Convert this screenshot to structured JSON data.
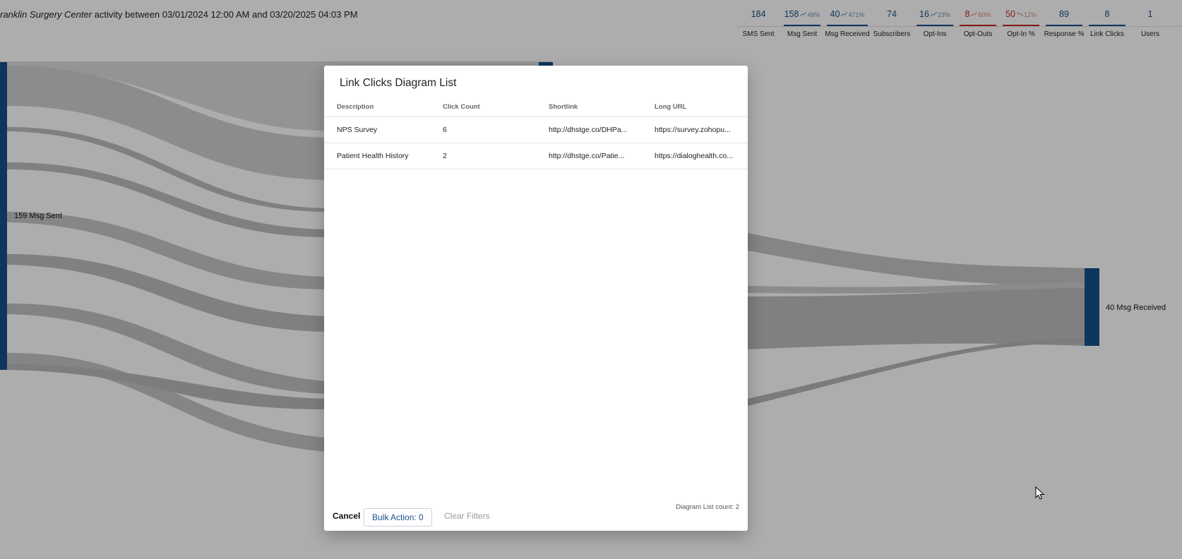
{
  "header": {
    "org_name": "ranklin Surgery Center",
    "activity_text": " activity between 03/01/2024 12:00 AM and 03/20/2025 04:03 PM"
  },
  "stats": [
    {
      "value": "184",
      "percent": "",
      "trend": "",
      "label": "SMS Sent",
      "tone": "blue"
    },
    {
      "value": "158",
      "percent": "49%",
      "trend": "up",
      "label": "Msg Sent",
      "tone": "blue"
    },
    {
      "value": "40",
      "percent": "471%",
      "trend": "up",
      "label": "Msg Received",
      "tone": "blue"
    },
    {
      "value": "74",
      "percent": "",
      "trend": "",
      "label": "Subscribers",
      "tone": "none"
    },
    {
      "value": "16",
      "percent": "23%",
      "trend": "up",
      "label": "Opt-Ins",
      "tone": "blue"
    },
    {
      "value": "8",
      "percent": "60%",
      "trend": "up",
      "label": "Opt-Outs",
      "tone": "red"
    },
    {
      "value": "50",
      "percent": "12%",
      "trend": "down",
      "label": "Opt-In %",
      "tone": "red"
    },
    {
      "value": "89",
      "percent": "",
      "trend": "",
      "label": "Response %",
      "tone": "blue"
    },
    {
      "value": "8",
      "percent": "",
      "trend": "",
      "label": "Link Clicks",
      "tone": "blue"
    },
    {
      "value": "1",
      "percent": "",
      "trend": "",
      "label": "Users",
      "tone": "none"
    }
  ],
  "colors": {
    "accent_blue": "#1a4f8a",
    "red": "#c62828",
    "node_blue": "#154f8a",
    "link_gray": "#c4c4c4",
    "overlay": "rgba(0,0,0,0.32)"
  },
  "sankey": {
    "left_node_label": "159 Msg Sent",
    "right_node_label": "40 Msg Received"
  },
  "modal": {
    "title": "Link Clicks Diagram List",
    "columns": [
      "Description",
      "Click Count",
      "Shortlink",
      "Long URL"
    ],
    "rows": [
      {
        "description": "NPS Survey",
        "click_count": "6",
        "shortlink": "http://dhstge.co/DHPa...",
        "long_url": "https://survey.zohopu..."
      },
      {
        "description": "Patient Health History",
        "click_count": "2",
        "shortlink": "http://dhstge.co/Patie...",
        "long_url": "https://dialoghealth.co..."
      }
    ],
    "footer": {
      "count_text": "Diagram List count: 2",
      "cancel_label": "Cancel",
      "bulk_label": "Bulk Action: 0",
      "clear_label": "Clear Filters"
    }
  }
}
